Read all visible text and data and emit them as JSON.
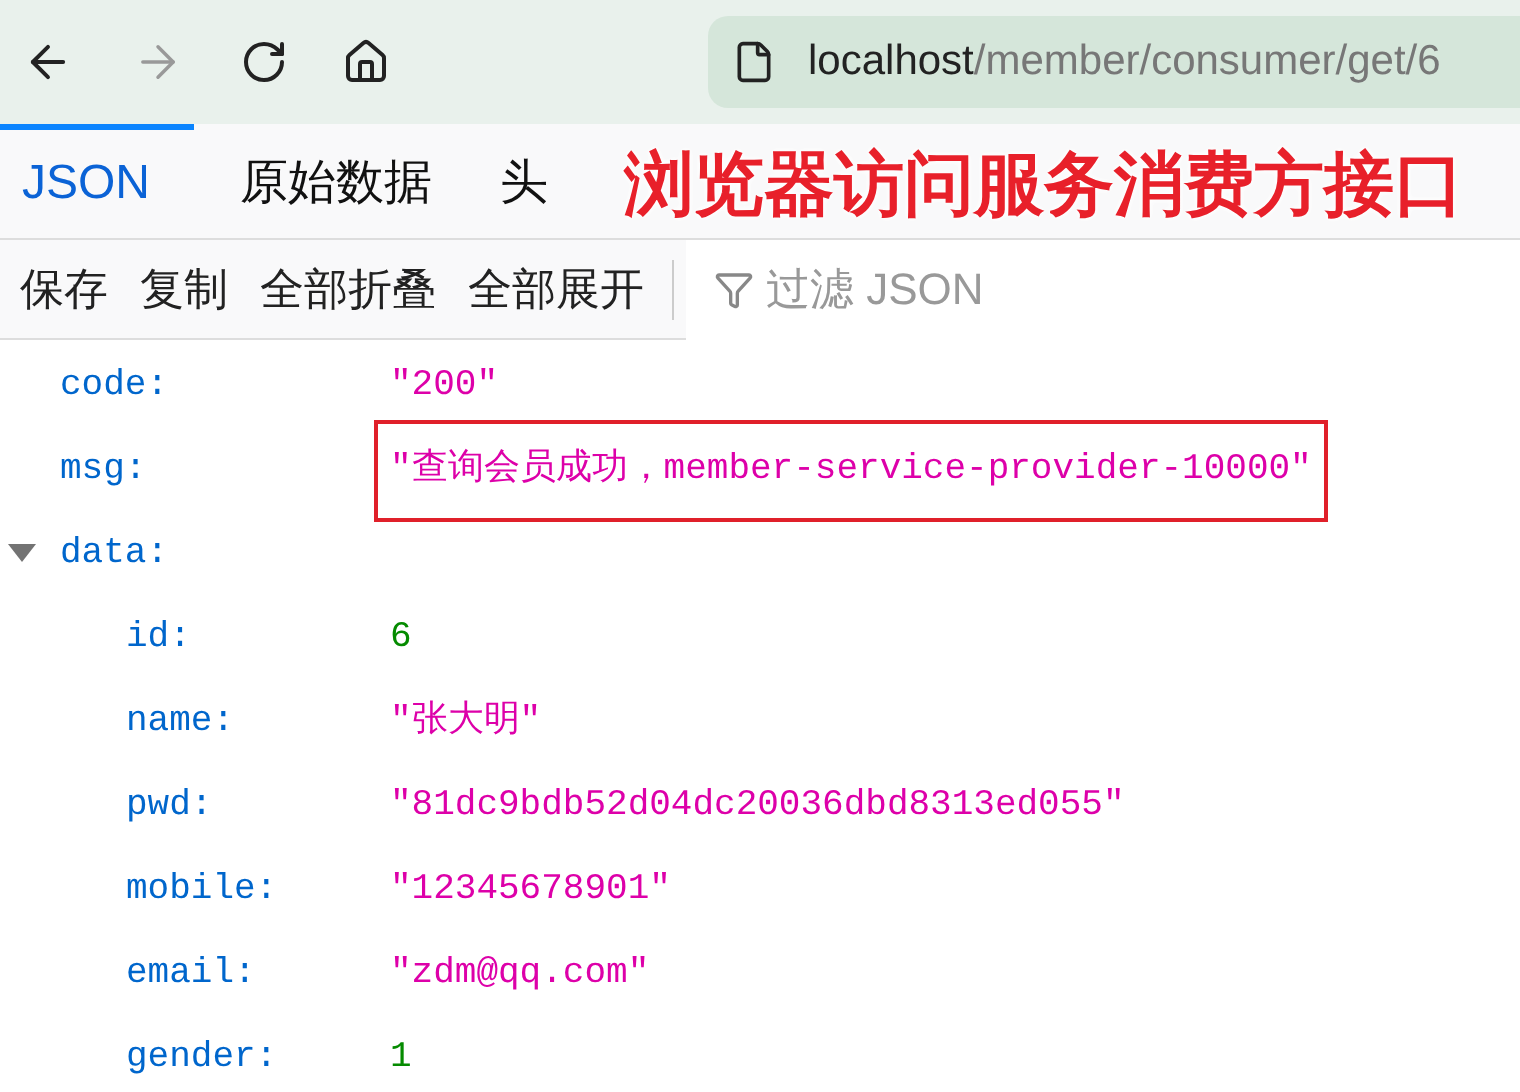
{
  "browser": {
    "url_host": "localhost",
    "url_path": "/member/consumer/get/6"
  },
  "tabs": [
    {
      "label": "JSON",
      "selected": true
    },
    {
      "label": "原始数据",
      "selected": false
    },
    {
      "label": "头",
      "selected": false
    }
  ],
  "annotation": "浏览器访问服务消费方接口",
  "toolbar": {
    "buttons": [
      "保存",
      "复制",
      "全部折叠",
      "全部展开"
    ],
    "filter": {
      "placeholder": "过滤 JSON"
    }
  },
  "rows": [
    {
      "key": "code:",
      "kind": "string",
      "value": "\"200\"",
      "highlighted": false
    },
    {
      "key": "msg:",
      "kind": "string",
      "value": "\"查询会员成功，member-service-provider-10000\"",
      "highlighted": true
    },
    {
      "key": "data:",
      "kind": "object",
      "expanded": true,
      "children": [
        {
          "key": "id:",
          "kind": "number",
          "value": "6"
        },
        {
          "key": "name:",
          "kind": "string",
          "value": "\"张大明\""
        },
        {
          "key": "pwd:",
          "kind": "string",
          "value": "\"81dc9bdb52d04dc20036dbd8313ed055\""
        },
        {
          "key": "mobile:",
          "kind": "string",
          "value": "\"12345678901\""
        },
        {
          "key": "email:",
          "kind": "string",
          "value": "\"zdm@qq.com\""
        },
        {
          "key": "gender:",
          "kind": "number",
          "value": "1"
        }
      ]
    }
  ]
}
